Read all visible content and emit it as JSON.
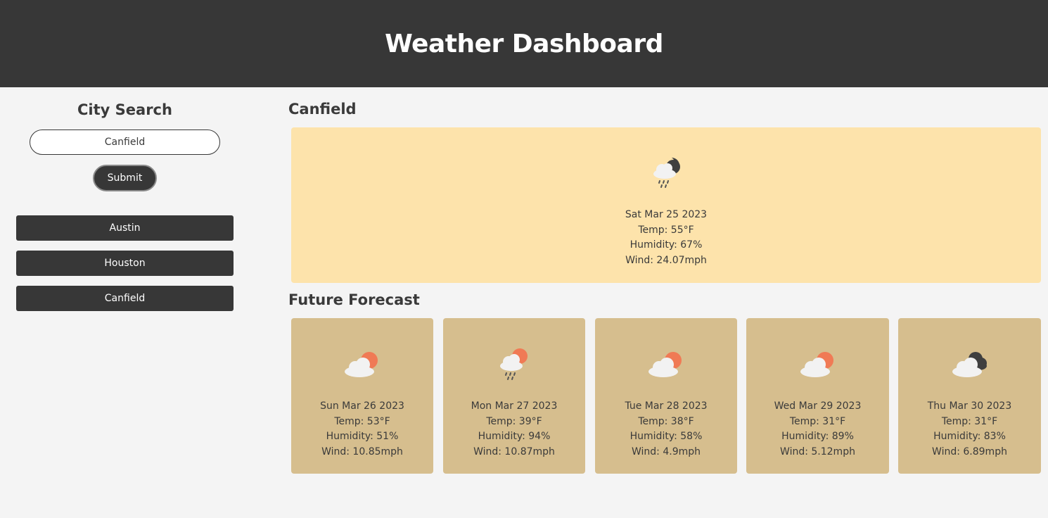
{
  "header": {
    "title": "Weather Dashboard"
  },
  "sidebar": {
    "title": "City Search",
    "search_value": "Canfield",
    "submit_label": "Submit",
    "history": [
      "Austin",
      "Houston",
      "Canfield"
    ]
  },
  "current": {
    "city": "Canfield",
    "icon": "rain-cloud-moon-icon",
    "date": "Sat Mar 25 2023",
    "temp": "Temp: 55°F",
    "humidity": "Humidity: 67%",
    "wind": "Wind: 24.07mph"
  },
  "forecast_title": "Future Forecast",
  "forecast": [
    {
      "icon": "cloud-sun-icon",
      "date": "Sun Mar 26 2023",
      "temp": "Temp: 53°F",
      "humidity": "Humidity: 51%",
      "wind": "Wind: 10.85mph"
    },
    {
      "icon": "rain-cloud-sun-icon",
      "date": "Mon Mar 27 2023",
      "temp": "Temp: 39°F",
      "humidity": "Humidity: 94%",
      "wind": "Wind: 10.87mph"
    },
    {
      "icon": "cloud-sun-icon",
      "date": "Tue Mar 28 2023",
      "temp": "Temp: 38°F",
      "humidity": "Humidity: 58%",
      "wind": "Wind: 4.9mph"
    },
    {
      "icon": "cloud-sun-icon",
      "date": "Wed Mar 29 2023",
      "temp": "Temp: 31°F",
      "humidity": "Humidity: 89%",
      "wind": "Wind: 5.12mph"
    },
    {
      "icon": "overcast-clouds-icon",
      "date": "Thu Mar 30 2023",
      "temp": "Temp: 31°F",
      "humidity": "Humidity: 83%",
      "wind": "Wind: 6.89mph"
    }
  ],
  "colors": {
    "header_bg": "#373737",
    "page_bg": "#f4f4f4",
    "current_card_bg": "#fde3ab",
    "forecast_card_bg": "#d6be8e",
    "sun": "#f07a55",
    "cloud": "#f2f2f2",
    "dark_cloud": "#3f3f3f"
  }
}
